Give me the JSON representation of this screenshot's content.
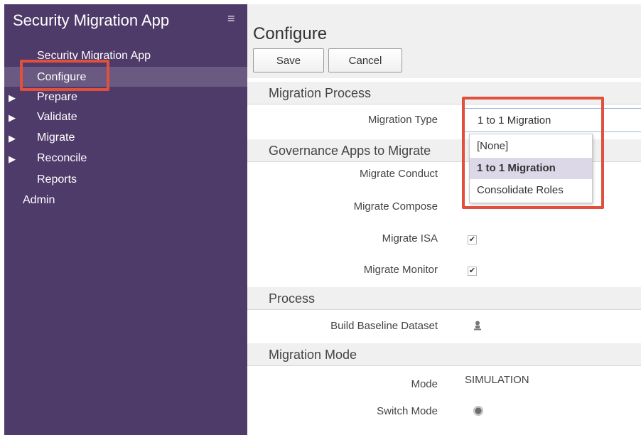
{
  "sidebar": {
    "app_title": "Security Migration App",
    "menu_icon": "hamburger-icon",
    "items": [
      {
        "label": "Security Migration App"
      },
      {
        "label": "Configure"
      },
      {
        "label": "Prepare"
      },
      {
        "label": "Validate"
      },
      {
        "label": "Migrate"
      },
      {
        "label": "Reconcile"
      },
      {
        "label": "Reports"
      },
      {
        "label": "Admin"
      }
    ]
  },
  "main": {
    "title": "Configure",
    "toolbar": {
      "save_label": "Save",
      "cancel_label": "Cancel"
    },
    "sections": {
      "migration_process": {
        "header": "Migration Process",
        "migration_type_label": "Migration Type",
        "migration_type_value": "1 to 1 Migration"
      },
      "governance_apps": {
        "header": "Governance Apps to Migrate",
        "fields": [
          {
            "label": "Migrate Conduct",
            "checked": false
          },
          {
            "label": "Migrate Compose",
            "checked": false
          },
          {
            "label": "Migrate ISA",
            "checked": true
          },
          {
            "label": "Migrate Monitor",
            "checked": true
          }
        ],
        "check_mark": "✔"
      },
      "process": {
        "header": "Process",
        "build_label": "Build Baseline Dataset",
        "build_icon": "run-job-icon"
      },
      "migration_mode": {
        "header": "Migration Mode",
        "mode_label": "Mode",
        "mode_value": "SIMULATION",
        "switch_label": "Switch Mode"
      }
    },
    "dropdown": {
      "options": [
        "[None]",
        "1 to 1 Migration",
        "Consolidate Roles"
      ],
      "selected": "1 to 1 Migration"
    }
  },
  "colors": {
    "sidebar_bg": "#4f3b6a",
    "highlight": "#e0503c",
    "selected_option_bg": "#dcd8e8"
  }
}
